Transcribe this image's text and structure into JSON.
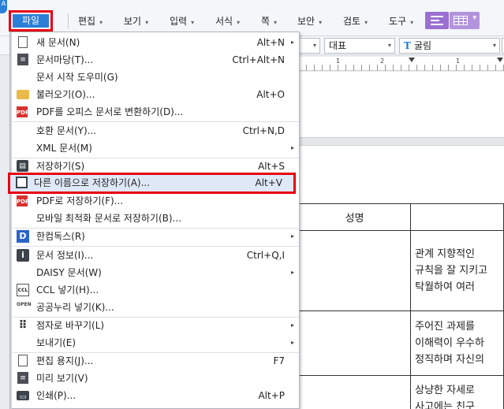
{
  "menubar": {
    "corner_label": "A",
    "items": [
      {
        "label": "파일"
      },
      {
        "label": "편집"
      },
      {
        "label": "보기"
      },
      {
        "label": "입력"
      },
      {
        "label": "서식"
      },
      {
        "label": "쪽"
      },
      {
        "label": "보안"
      },
      {
        "label": "검토"
      },
      {
        "label": "도구"
      }
    ],
    "caret": "▾"
  },
  "toolbar2": {
    "style_combo": "대표",
    "font_combo": "굴림",
    "font_icon": "T"
  },
  "ruler": {
    "labels": [
      "1",
      "2",
      "1"
    ]
  },
  "file_menu": {
    "items": [
      {
        "label": "새 문서(N)",
        "shortcut": "Alt+N",
        "submenu": true
      },
      {
        "label": "문서마당(T)...",
        "shortcut": "Ctrl+Alt+N"
      },
      {
        "label": "문서 시작 도우미(G)",
        "shortcut": ""
      },
      {
        "label": "불러오기(O)...",
        "shortcut": "Alt+O"
      },
      {
        "label": "PDF를 오피스 문서로 변환하기(D)...",
        "shortcut": ""
      },
      {
        "label": "호환 문서(Y)...",
        "shortcut": "Ctrl+N,D"
      },
      {
        "label": "XML 문서(M)",
        "shortcut": "",
        "submenu": true
      },
      {
        "label": "저장하기(S)",
        "shortcut": "Alt+S"
      },
      {
        "label": "다른 이름으로 저장하기(A)...",
        "shortcut": "Alt+V"
      },
      {
        "label": "PDF로 저장하기(F)...",
        "shortcut": ""
      },
      {
        "label": "모바일 최적화 문서로 저장하기(B)...",
        "shortcut": ""
      },
      {
        "label": "한컴독스(R)",
        "shortcut": "",
        "submenu": true
      },
      {
        "label": "문서 정보(I)...",
        "shortcut": "Ctrl+Q,I"
      },
      {
        "label": "DAISY 문서(W)",
        "shortcut": "",
        "submenu": true
      },
      {
        "label": "CCL 넣기(H)...",
        "shortcut": ""
      },
      {
        "label": "공공누리 넣기(K)...",
        "shortcut": ""
      },
      {
        "label": "점자로 바꾸기(L)",
        "shortcut": "",
        "submenu": true
      },
      {
        "label": "보내기(E)",
        "shortcut": "",
        "submenu": true
      },
      {
        "label": "편집 용지(J)...",
        "shortcut": "F7"
      },
      {
        "label": "미리 보기(V)",
        "shortcut": ""
      },
      {
        "label": "인쇄(P)...",
        "shortcut": "Alt+P"
      }
    ],
    "submenu_arrow": "▸",
    "icon_labels": {
      "pdf": "PDF",
      "save": "▤",
      "hancom": "D",
      "info": "i",
      "ccl": "CCL",
      "open": "OPEN",
      "braille": "⠿",
      "print": "▭",
      "docfill": "≡"
    }
  },
  "document": {
    "header": "성명",
    "rows": [
      [
        "관계 지향적인 ",
        "규칙을 잘 지키고",
        "탁월하여 여러 "
      ],
      [
        "주어진 과제를 ",
        "이해력이 우수하",
        "정직하며 자신의"
      ],
      [
        "상냥한 자세로 ",
        "사고에는 친구"
      ]
    ]
  },
  "colors": {
    "accent": "#2b7fd6",
    "highlight_border": "#e60012",
    "view_button": "#9a6fd1"
  }
}
